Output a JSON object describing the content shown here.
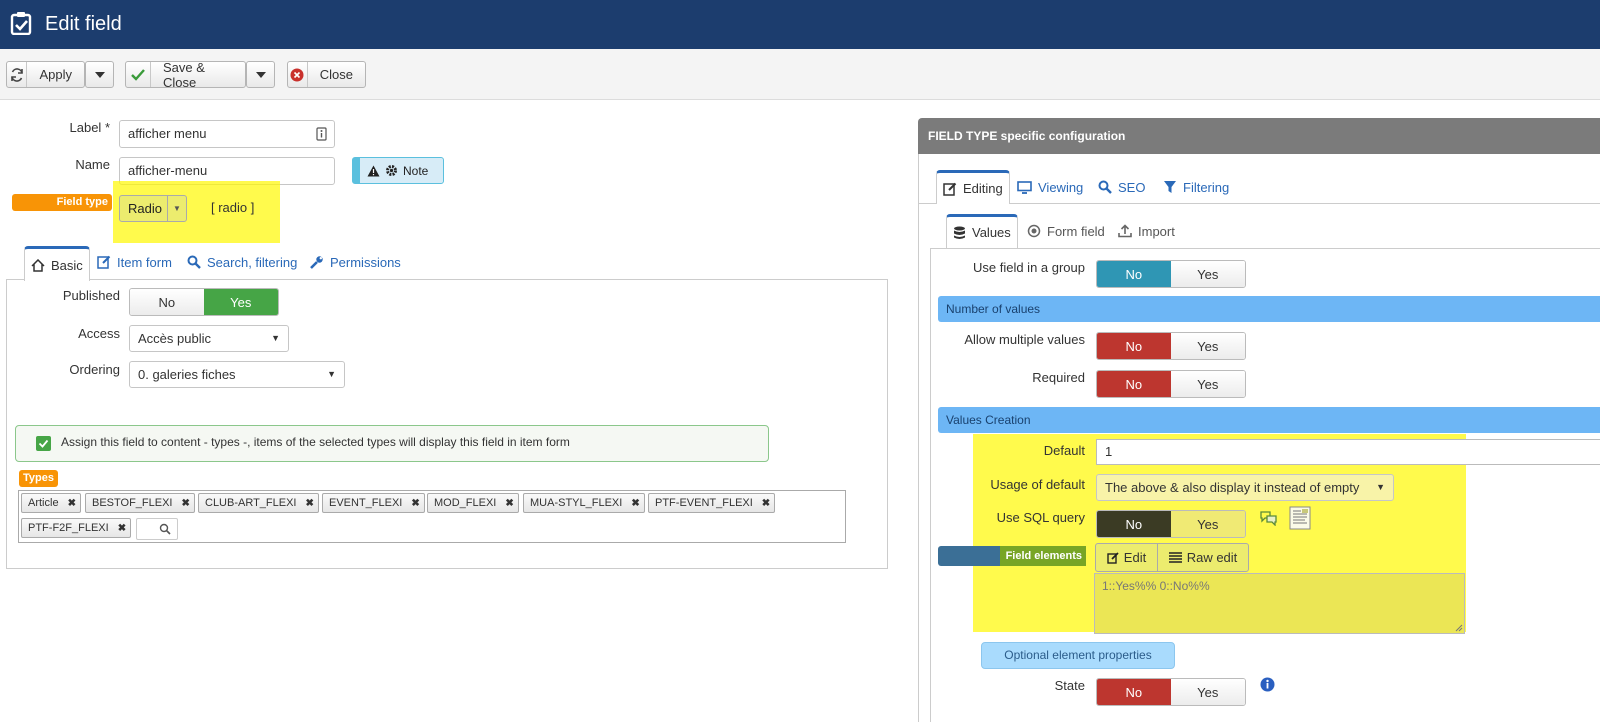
{
  "header": {
    "title": "Edit field"
  },
  "toolbar": {
    "apply": "Apply",
    "save_close": "Save & Close",
    "close": "Close"
  },
  "form": {
    "label": {
      "label": "Label",
      "required_mark": "*",
      "value": "afficher menu"
    },
    "name": {
      "label": "Name",
      "value": "afficher-menu"
    },
    "note_button": "Note",
    "field_type": {
      "label": "Field type",
      "value": "Radio",
      "code": "[ radio ]"
    }
  },
  "left_tabs": {
    "basic": "Basic",
    "item_form": "Item form",
    "search": "Search, filtering",
    "permissions": "Permissions"
  },
  "basic": {
    "published": {
      "label": "Published",
      "no": "No",
      "yes": "Yes"
    },
    "access": {
      "label": "Access",
      "value": "Accès public"
    },
    "ordering": {
      "label": "Ordering",
      "value": "0. galeries fiches"
    },
    "assign_text": "Assign this field to content - types -, items of the selected types will display this field in item form",
    "types_label": "Types",
    "types": [
      "Article",
      "BESTOF_FLEXI",
      "CLUB-ART_FLEXI",
      "EVENT_FLEXI",
      "MOD_FLEXI",
      "MUA-STYL_FLEXI",
      "PTF-EVENT_FLEXI",
      "PTF-F2F_FLEXI"
    ],
    "remove_glyph": "✖"
  },
  "right": {
    "panel_title": "FIELD TYPE specific configuration",
    "tabs": {
      "editing": "Editing",
      "viewing": "Viewing",
      "seo": "SEO",
      "filtering": "Filtering"
    },
    "subtabs": {
      "values": "Values",
      "form_field": "Form field",
      "import": "Import"
    },
    "use_group": {
      "label": "Use field in a group",
      "no": "No",
      "yes": "Yes"
    },
    "number_of_values": "Number of values",
    "allow_multiple": {
      "label": "Allow multiple values",
      "no": "No",
      "yes": "Yes"
    },
    "required": {
      "label": "Required",
      "no": "No",
      "yes": "Yes"
    },
    "values_creation": "Values Creation",
    "default": {
      "label": "Default",
      "value": "1"
    },
    "usage_default": {
      "label": "Usage of default",
      "value": "The above & also display it instead of empty"
    },
    "use_sql": {
      "label": "Use SQL query",
      "no": "No",
      "yes": "Yes"
    },
    "field_elements": {
      "label": "Field elements",
      "edit": "Edit",
      "raw_edit": "Raw edit",
      "value": "1::Yes%% 0::No%%"
    },
    "optional_props": "Optional element properties",
    "state": {
      "label": "State",
      "no": "No",
      "yes": "Yes"
    }
  }
}
